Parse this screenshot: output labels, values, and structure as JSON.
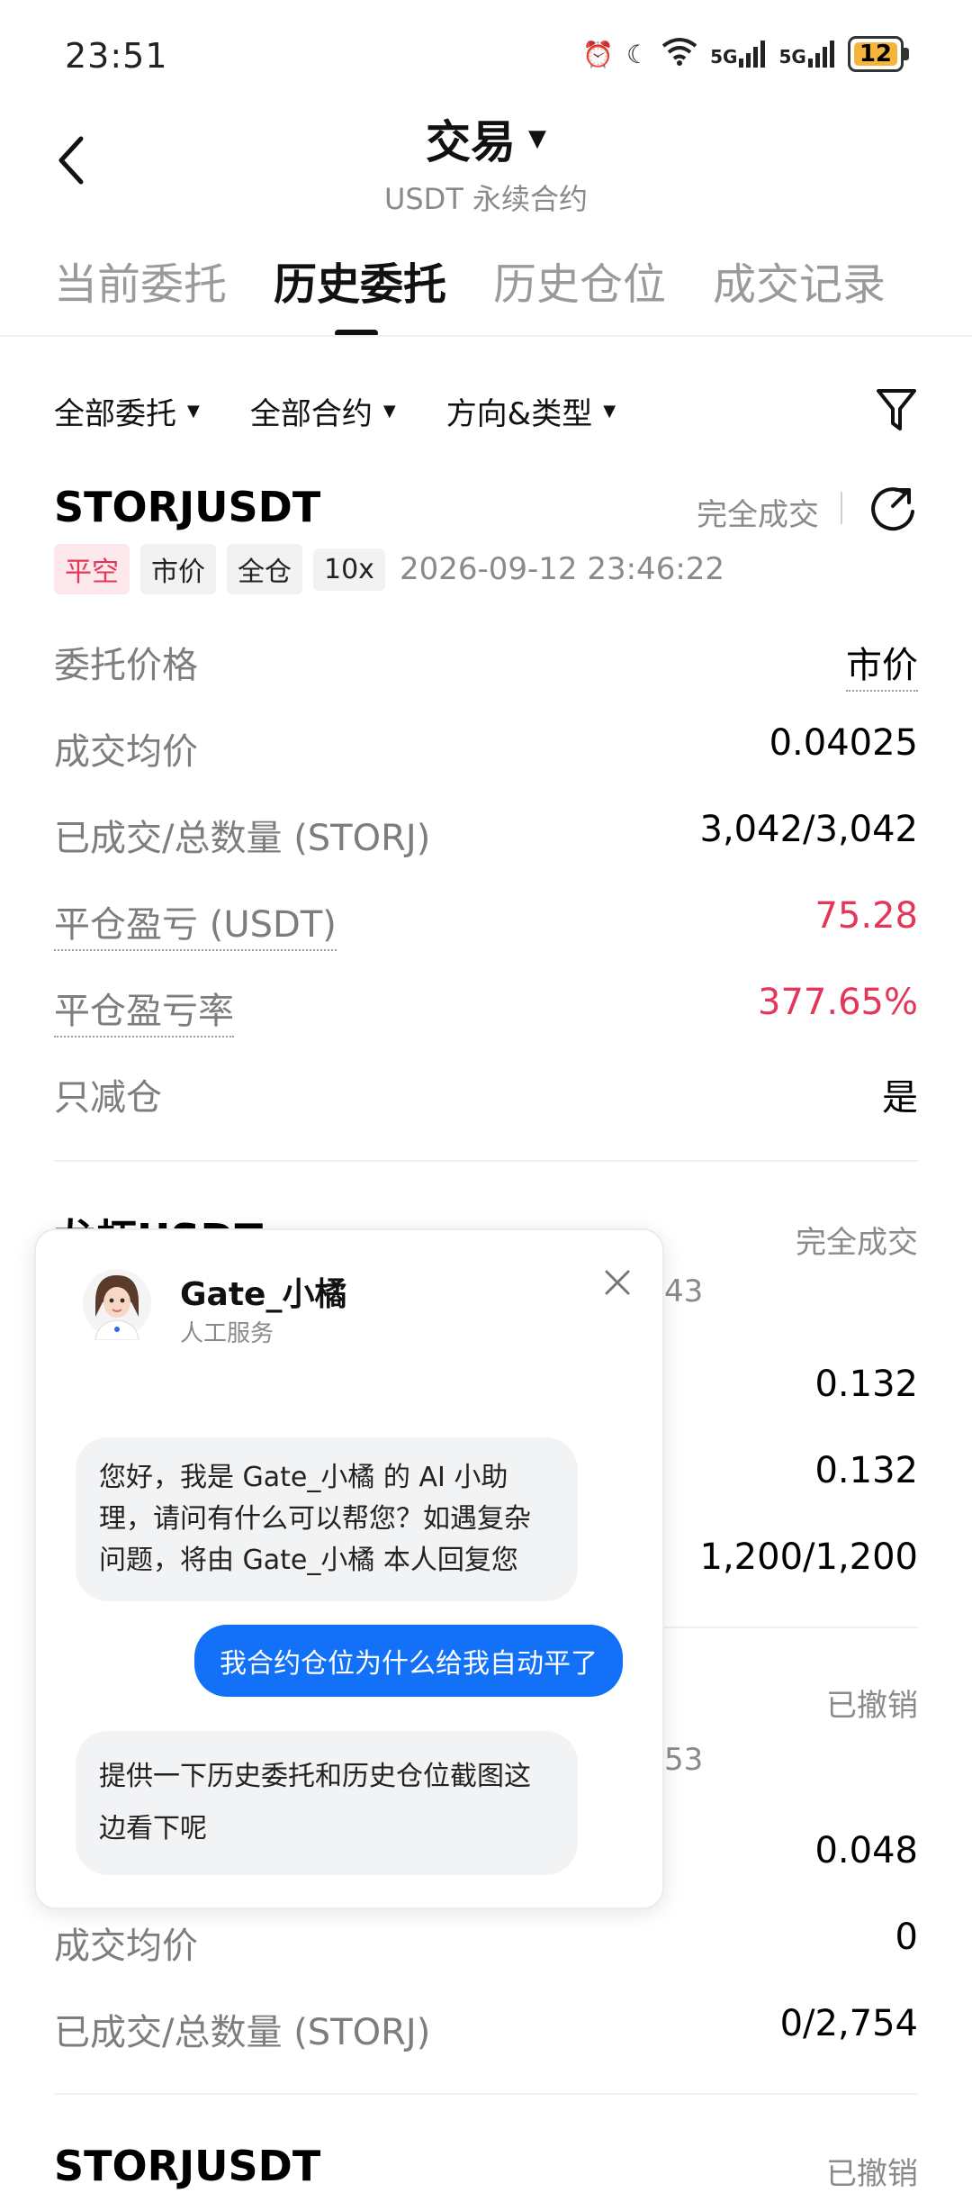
{
  "status_bar": {
    "time": "23:51",
    "signal1": "5G",
    "signal2": "5G",
    "battery": "12"
  },
  "header": {
    "title": "交易",
    "subtitle": "USDT 永续合约"
  },
  "tabs": [
    {
      "label": "当前委托"
    },
    {
      "label": "历史委托"
    },
    {
      "label": "历史仓位"
    },
    {
      "label": "成交记录"
    }
  ],
  "filters": [
    {
      "label": "全部委托"
    },
    {
      "label": "全部合约"
    },
    {
      "label": "方向&类型"
    }
  ],
  "order1": {
    "symbol": "STORJUSDT",
    "status": "完全成交",
    "tags": [
      "平空",
      "市价",
      "全仓",
      "10x"
    ],
    "time": "2026-09-12 23:46:22",
    "rows": [
      {
        "label": "委托价格",
        "value": "市价"
      },
      {
        "label": "成交均价",
        "value": "0.04025"
      },
      {
        "label": "已成交/总数量 (STORJ)",
        "value": "3,042/3,042"
      },
      {
        "label": "平仓盈亏 (USDT)",
        "value": "75.28"
      },
      {
        "label": "平仓盈亏率",
        "value": "377.65%"
      },
      {
        "label": "只减仓",
        "value": "是"
      }
    ]
  },
  "order2": {
    "title_partial": "龙虾USDT",
    "status": "完全成交",
    "time_tail": "43",
    "values": [
      "0.132",
      "0.132",
      "1,200/1,200"
    ]
  },
  "order3": {
    "status": "已撤销",
    "time_tail": "53",
    "values": [
      "0.048"
    ],
    "rows": [
      {
        "label": "成交均价",
        "value": "0"
      },
      {
        "label": "已成交/总数量 (STORJ)",
        "value": "0/2,754"
      }
    ]
  },
  "order4": {
    "symbol": "STORJUSDT",
    "status": "已撤销"
  },
  "chat": {
    "name": "Gate_小橘",
    "role": "人工服务",
    "messages": [
      {
        "from": "bot",
        "text": "您好，我是 Gate_小橘 的 AI 小助理，请问有什么可以帮您？如遇复杂问题，将由 Gate_小橘 本人回复您"
      },
      {
        "from": "user",
        "text": "我合约仓位为什么给我自动平了"
      },
      {
        "from": "bot",
        "text": "提供一下历史委托和历史仓位截图这边看下呢"
      }
    ]
  },
  "colors": {
    "accent_red": "#e5365a",
    "chat_blue": "#1371f7",
    "battery": "#f6b53a"
  }
}
